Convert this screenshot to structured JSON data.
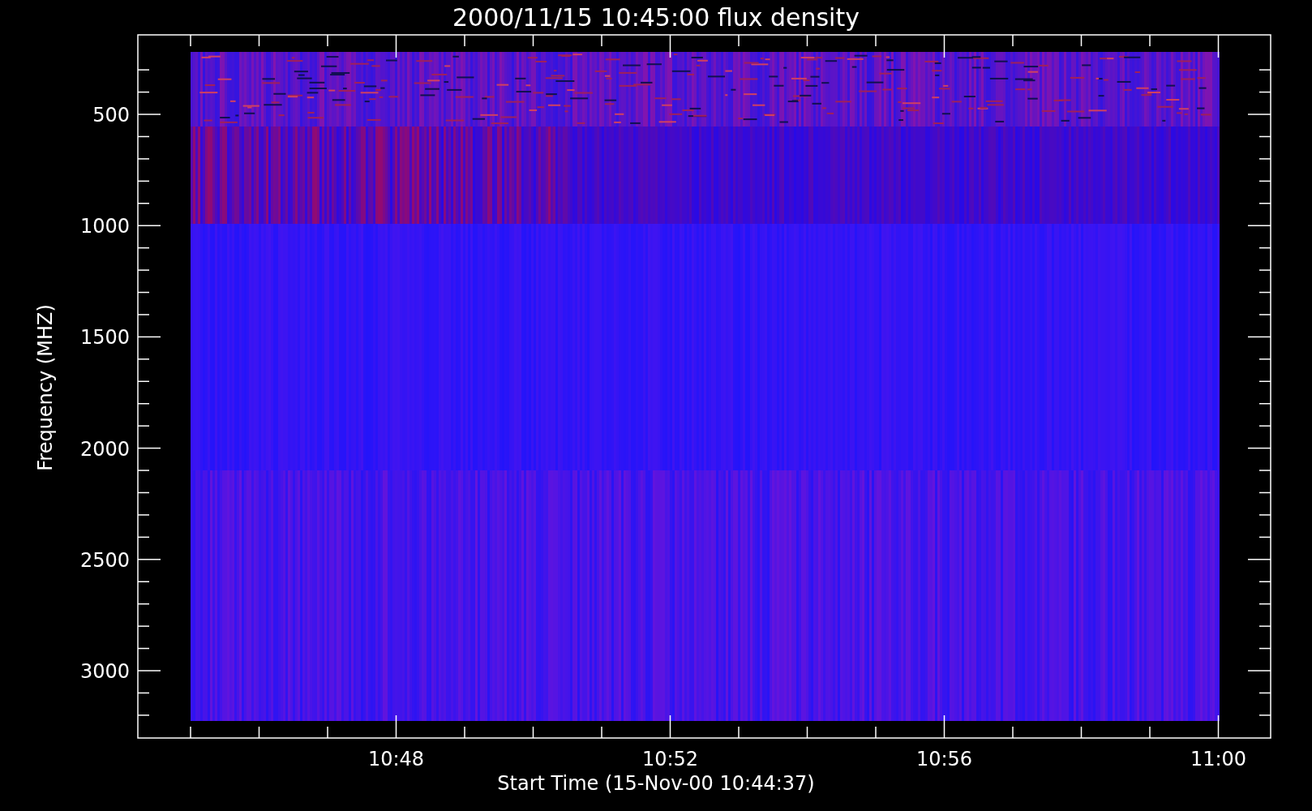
{
  "title": "2000/11/15 10:45:00 flux density",
  "y_axis": {
    "label": "Frequency (MHZ)",
    "ticks": [
      "500",
      "1000",
      "1500",
      "2000",
      "2500",
      "3000"
    ]
  },
  "x_axis": {
    "label": "Start Time (15-Nov-00 10:44:37)",
    "ticks": [
      "10:48",
      "10:52",
      "10:56",
      "11:00"
    ]
  }
}
